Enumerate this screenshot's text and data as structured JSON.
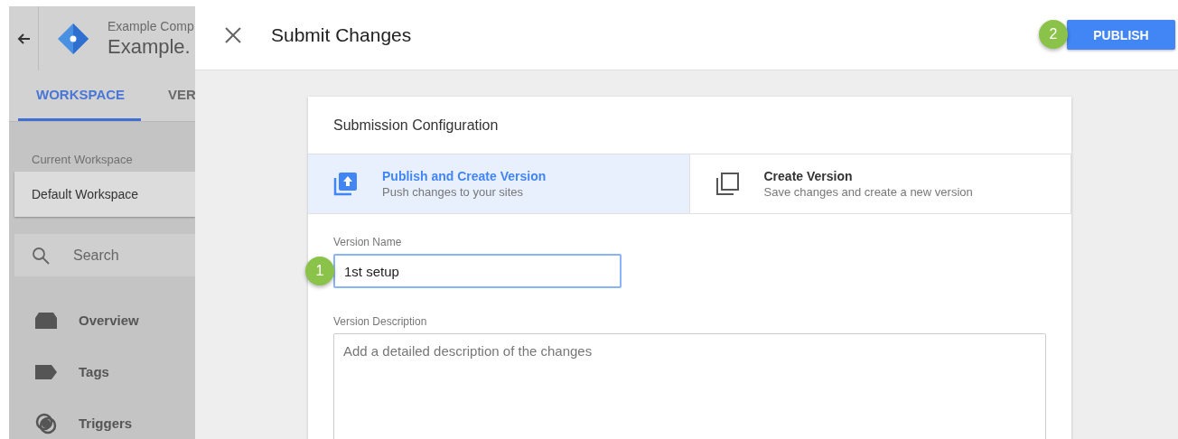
{
  "background_app": {
    "account": "Example Comp",
    "container": "Example.",
    "tabs": [
      {
        "label": "WORKSPACE",
        "selected": true
      },
      {
        "label": "VER",
        "selected": false
      }
    ],
    "workspace": {
      "label": "Current Workspace",
      "value": "Default Workspace"
    },
    "search": {
      "placeholder": "Search"
    },
    "nav": [
      {
        "label": "Overview",
        "kind": "overview"
      },
      {
        "label": "Tags",
        "kind": "tags"
      },
      {
        "label": "Triggers",
        "kind": "triggers"
      }
    ]
  },
  "drawer": {
    "title": "Submit Changes",
    "publish_button": {
      "label": "PUBLISH",
      "step": "2"
    },
    "card": {
      "title": "Submission Configuration",
      "options": [
        {
          "kind": "publish",
          "title": "Publish and Create Version",
          "subtitle": "Push changes to your sites",
          "selected": true
        },
        {
          "kind": "version",
          "title": "Create Version",
          "subtitle": "Save changes and create a new version",
          "selected": false
        }
      ],
      "version_name": {
        "label": "Version Name",
        "value": "1st setup",
        "step": "1"
      },
      "version_description": {
        "label": "Version Description",
        "placeholder": "Add a detailed description of the changes"
      }
    }
  }
}
